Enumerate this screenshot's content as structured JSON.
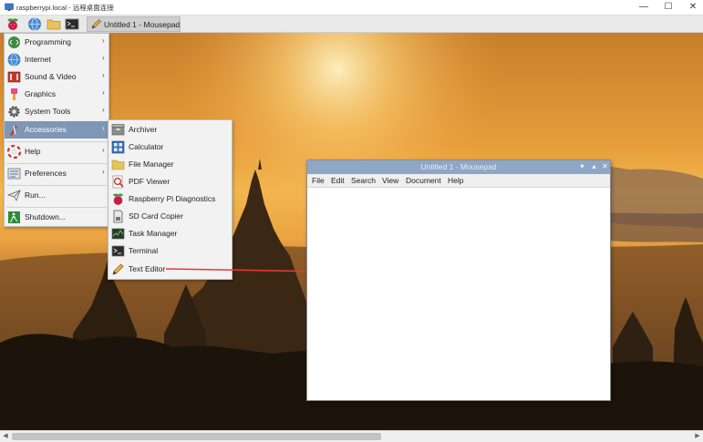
{
  "outer_window": {
    "title": "raspberrypi.local - 远程桌面连接",
    "controls": {
      "minimize": "—",
      "maximize": "☐",
      "close": "✕"
    }
  },
  "taskbar": {
    "launchers": [
      "raspberry-menu-icon",
      "web-browser-icon",
      "file-manager-icon",
      "terminal-icon"
    ],
    "task_label": "Untitled 1 - Mousepad"
  },
  "main_menu": {
    "items": [
      {
        "label": "Programming",
        "icon": "programming-icon",
        "has_submenu": true
      },
      {
        "label": "Internet",
        "icon": "internet-globe-icon",
        "has_submenu": true
      },
      {
        "label": "Sound & Video",
        "icon": "sound-video-icon",
        "has_submenu": true
      },
      {
        "label": "Graphics",
        "icon": "graphics-icon",
        "has_submenu": true
      },
      {
        "label": "System Tools",
        "icon": "system-tools-gear-icon",
        "has_submenu": true
      },
      {
        "label": "Accessories",
        "icon": "accessories-icon",
        "has_submenu": true,
        "selected": true
      },
      {
        "label": "Help",
        "icon": "help-lifebuoy-icon",
        "has_submenu": true
      },
      {
        "label": "Preferences",
        "icon": "preferences-icon",
        "has_submenu": true
      },
      {
        "label": "Run...",
        "icon": "run-paper-plane-icon",
        "has_submenu": false
      },
      {
        "label": "Shutdown...",
        "icon": "shutdown-icon",
        "has_submenu": false
      }
    ],
    "arrow_glyph": "›"
  },
  "accessories_menu": {
    "items": [
      {
        "label": "Archiver",
        "icon": "archiver-icon"
      },
      {
        "label": "Calculator",
        "icon": "calculator-icon"
      },
      {
        "label": "File Manager",
        "icon": "folder-icon"
      },
      {
        "label": "PDF Viewer",
        "icon": "pdf-viewer-icon"
      },
      {
        "label": "Raspberry Pi Diagnostics",
        "icon": "raspberry-icon"
      },
      {
        "label": "SD Card Copier",
        "icon": "sd-card-icon"
      },
      {
        "label": "Task Manager",
        "icon": "task-manager-icon"
      },
      {
        "label": "Terminal",
        "icon": "terminal-icon"
      },
      {
        "label": "Text Editor",
        "icon": "pencil-icon"
      }
    ]
  },
  "mousepad": {
    "title": "Untitled 1 - Mousepad",
    "controls": {
      "minimize": "▾",
      "maximize": "▴",
      "close": "✕"
    },
    "menus": [
      "File",
      "Edit",
      "Search",
      "View",
      "Document",
      "Help"
    ]
  },
  "colors": {
    "menu_highlight": "#7f96b6",
    "window_titlebar": "#8fa7c6",
    "annotation_arrow": "#e53935"
  }
}
